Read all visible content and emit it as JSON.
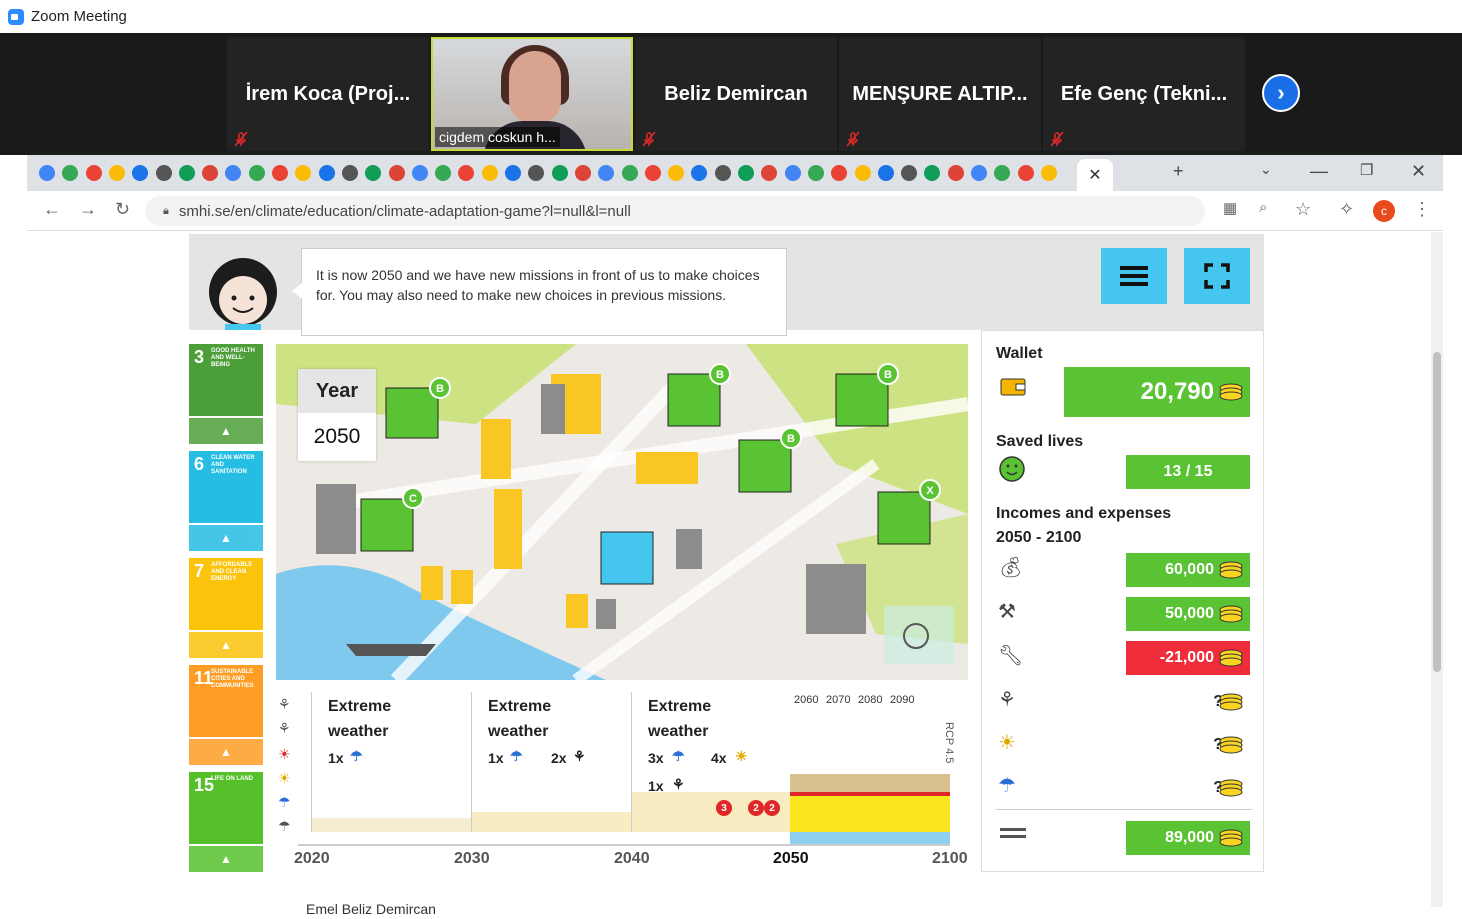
{
  "app": {
    "title": "Zoom Meeting"
  },
  "participants": [
    {
      "name": "İrem Koca (Proj...",
      "muted": true
    },
    {
      "name": "cigdem coskun h...",
      "muted": false,
      "video": true
    },
    {
      "name": "Beliz Demircan",
      "muted": true
    },
    {
      "name": "MENŞURE ALTIP...",
      "muted": true
    },
    {
      "name": "Efe Genç (Tekni...",
      "muted": true
    }
  ],
  "browser": {
    "url": "smhi.se/en/climate/education/climate-adaptation-game?l=null&l=null",
    "profile_initial": "c",
    "tab_close": "✕",
    "new_tab": "+"
  },
  "game": {
    "speech": "It is now 2050 and we have new missions in front of us to make choices for. You may also need to make new choices in previous missions.",
    "year_label": "Year",
    "year_value": "2050",
    "sdg_cards": [
      {
        "num": "3",
        "label": "GOOD HEALTH AND WELL-BEING",
        "color": "#4c9f38"
      },
      {
        "num": "6",
        "label": "CLEAN WATER AND SANITATION",
        "color": "#26bde2"
      },
      {
        "num": "7",
        "label": "AFFORDABLE AND CLEAN ENERGY",
        "color": "#fcc30b"
      },
      {
        "num": "11",
        "label": "SUSTAINABLE CITIES AND COMMUNITIES",
        "color": "#fd9d24"
      },
      {
        "num": "15",
        "label": "LIFE ON LAND",
        "color": "#56c02b"
      }
    ],
    "map_badges": [
      "B",
      "B",
      "B",
      "B",
      "C",
      "X"
    ],
    "timeline": {
      "periods": [
        {
          "title1": "Extreme",
          "title2": "weather",
          "events": [
            "1x"
          ]
        },
        {
          "title1": "Extreme",
          "title2": "weather",
          "events": [
            "1x",
            "2x"
          ]
        },
        {
          "title1": "Extreme",
          "title2": "weather",
          "events": [
            "3x",
            "4x",
            "1x"
          ]
        }
      ],
      "years": [
        "2020",
        "2030",
        "2040",
        "2050",
        "2100"
      ],
      "decades": [
        "2060",
        "2070",
        "2080",
        "2090"
      ],
      "scenario": "RCP 4.5",
      "marker_counts": [
        "3",
        "2",
        "2"
      ]
    },
    "panel": {
      "wallet_label": "Wallet",
      "wallet_value": "20,790",
      "saved_label": "Saved lives",
      "saved_value": "13 / 15",
      "ie_label": "Incomes and expenses",
      "ie_range": "2050 - 2100",
      "rows": [
        {
          "icon": "income-icon",
          "value": "60,000",
          "kind": "positive"
        },
        {
          "icon": "hammer-icon",
          "value": "50,000",
          "kind": "positive"
        },
        {
          "icon": "wrench-icon",
          "value": "-21,000",
          "kind": "negative"
        },
        {
          "icon": "storm-icon",
          "value": "?",
          "kind": "unknown"
        },
        {
          "icon": "sun-icon",
          "value": "?",
          "kind": "unknown"
        },
        {
          "icon": "rain-icon",
          "value": "?",
          "kind": "unknown"
        }
      ],
      "total_value": "89,000"
    },
    "colors": {
      "green": "#59c334",
      "red": "#ef2d3a",
      "blue_button": "#45c6ef"
    }
  },
  "below_text": "Emel Beliz Demircan"
}
